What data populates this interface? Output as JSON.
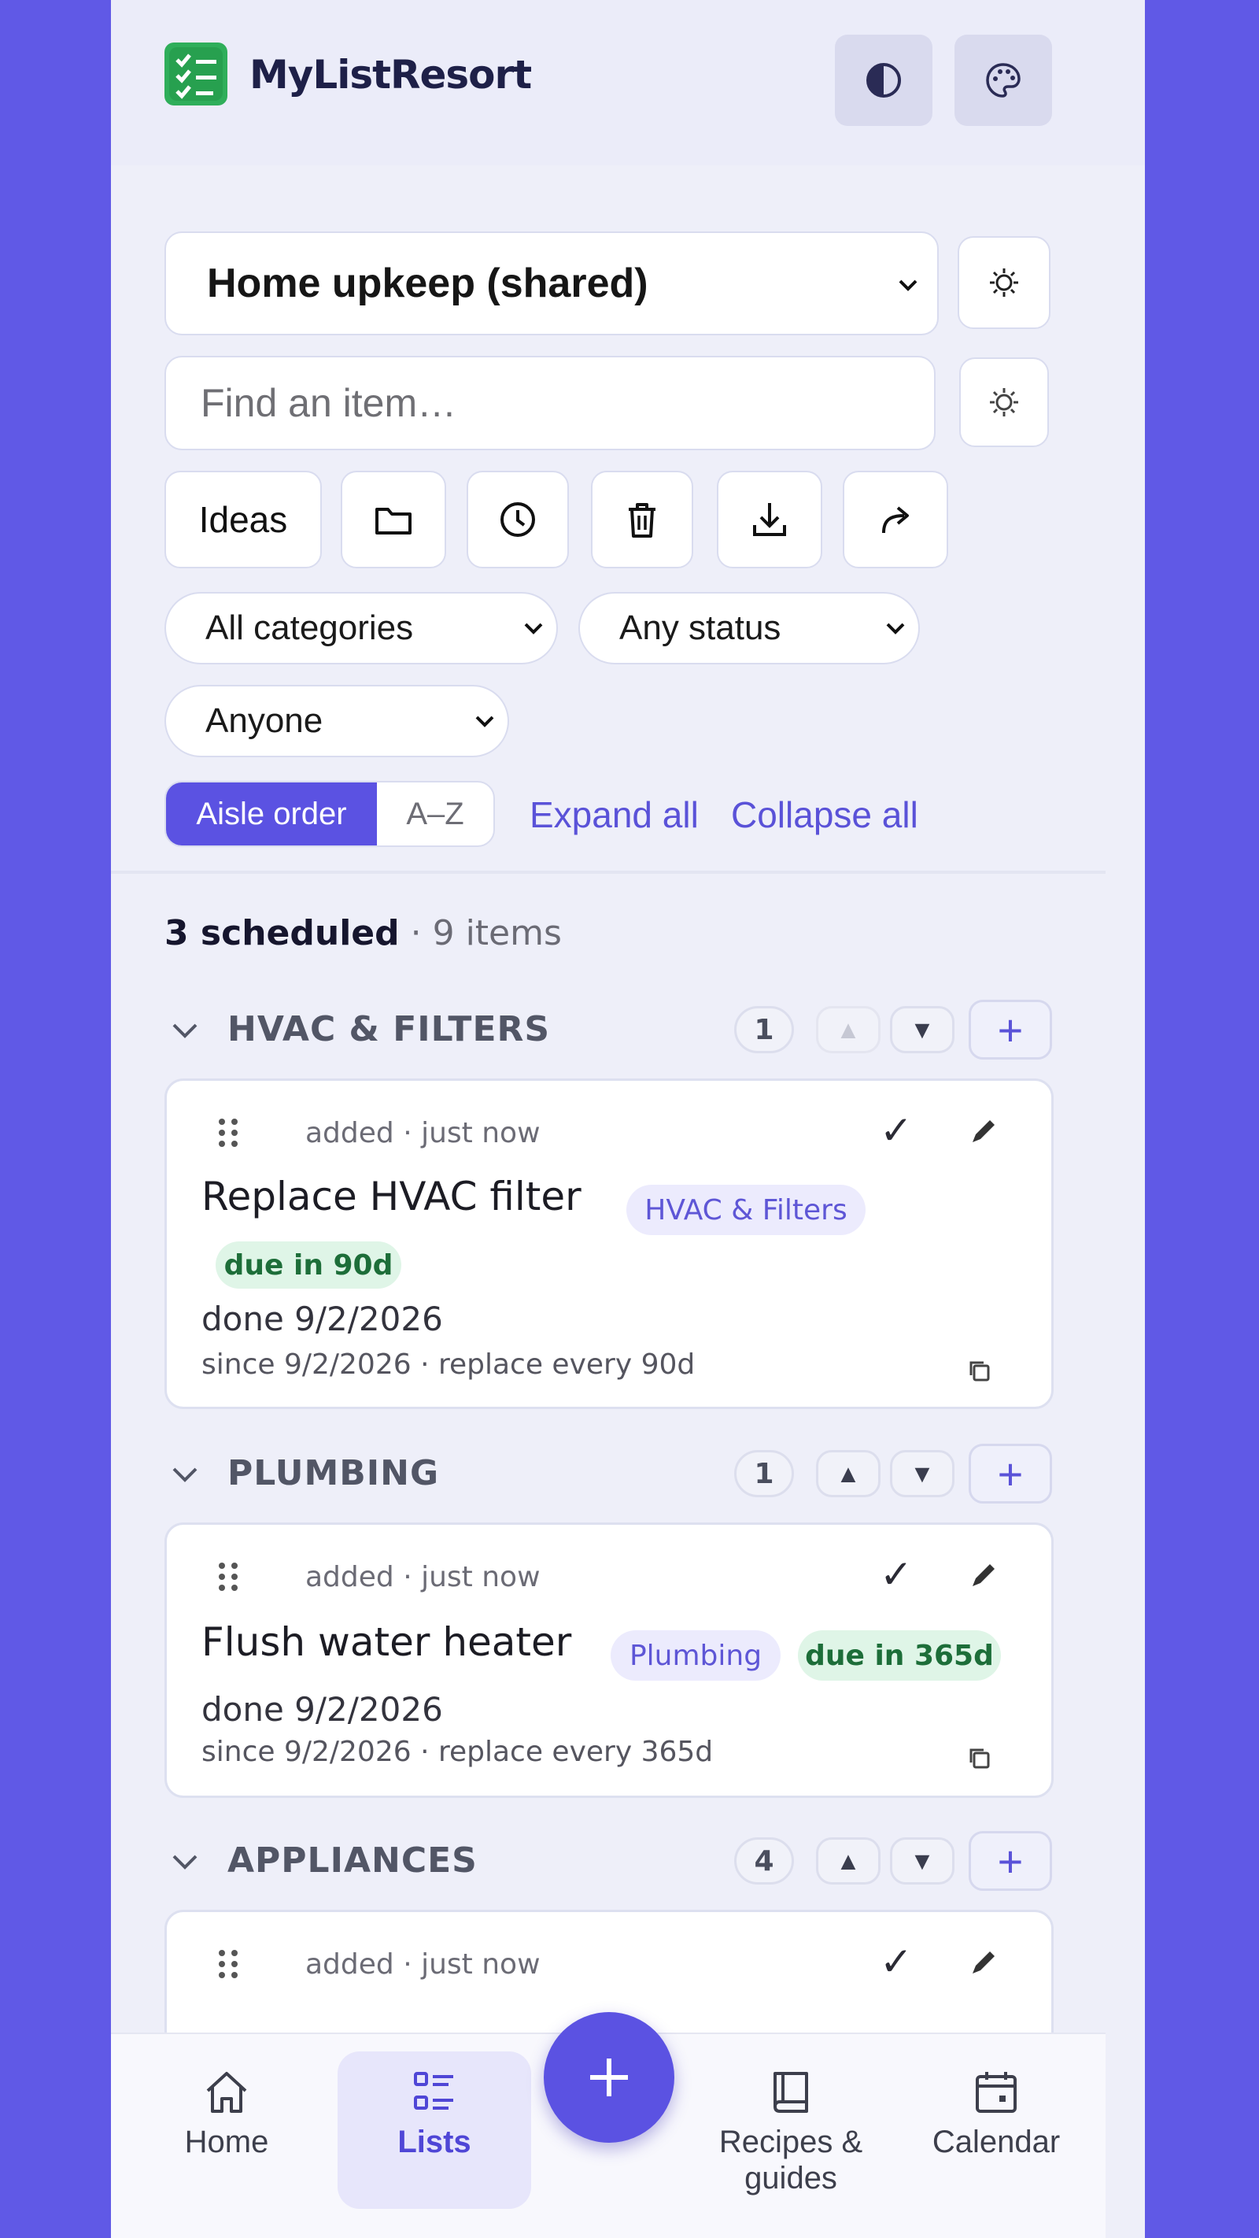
{
  "header": {
    "app_name": "MyListResort",
    "contrast_button": "contrast-toggle",
    "theme_button": "palette"
  },
  "list_selector": {
    "selected": "Home upkeep (shared)"
  },
  "search": {
    "placeholder": "Find an item…"
  },
  "toolbar": {
    "ideas_label": "Ideas",
    "icons": [
      "folder-icon",
      "clock-icon",
      "trash-icon",
      "download-icon",
      "share-icon"
    ]
  },
  "filters": {
    "category": "All categories",
    "status": "Any status",
    "person": "Anyone"
  },
  "sort": {
    "aisle_order": "Aisle order",
    "az": "A–Z",
    "expand_all": "Expand all",
    "collapse_all": "Collapse all"
  },
  "summary": {
    "scheduled": "3 scheduled",
    "items": " · 9 items"
  },
  "categories": [
    {
      "title": "HVAC & FILTERS",
      "count": "1",
      "items": [
        {
          "meta": "added · just now",
          "name": "Replace HVAC filter",
          "category_tag": "HVAC & Filters",
          "due": "due in 90d",
          "done": "done 9/2/2026",
          "since": "since 9/2/2026 · replace every 90d"
        }
      ]
    },
    {
      "title": "PLUMBING",
      "count": "1",
      "items": [
        {
          "meta": "added · just now",
          "name": "Flush water heater",
          "category_tag": "Plumbing",
          "due": "due in 365d",
          "done": "done 9/2/2026",
          "since": "since 9/2/2026 · replace every 365d"
        }
      ]
    },
    {
      "title": "APPLIANCES",
      "count": "4",
      "items": [
        {
          "meta": "added · just now"
        }
      ]
    }
  ],
  "nav": {
    "home": "Home",
    "lists": "Lists",
    "recipes_line1": "Recipes &",
    "recipes_line2": "guides",
    "calendar": "Calendar"
  },
  "colors": {
    "accent": "#5b52e2",
    "outer_bg": "#6059e6",
    "due_green": "#1d6e39"
  }
}
